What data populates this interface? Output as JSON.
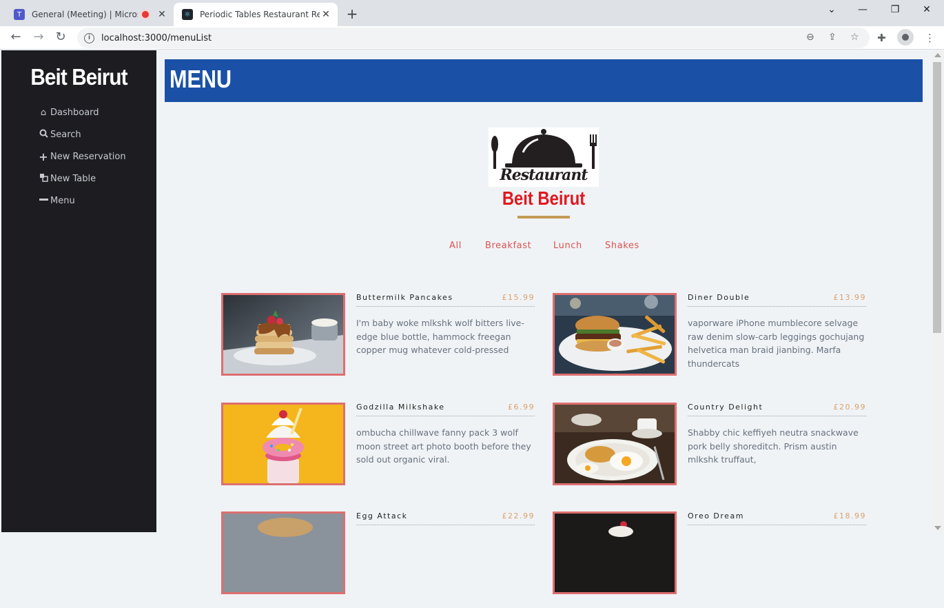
{
  "browser": {
    "tabs": [
      {
        "title": "General (Meeting) | Microsof",
        "favicon": "teams-icon",
        "active": false
      },
      {
        "title": "Periodic Tables Restaurant Reserv",
        "favicon": "react-icon",
        "active": true
      }
    ],
    "url": "localhost:3000/menuList"
  },
  "sidebar": {
    "brand": "Beit Beirut",
    "items": [
      {
        "label": "Dashboard",
        "icon": "home-icon"
      },
      {
        "label": "Search",
        "icon": "search-icon"
      },
      {
        "label": "New Reservation",
        "icon": "plus-icon"
      },
      {
        "label": "New Table",
        "icon": "table-icon"
      },
      {
        "label": "Menu",
        "icon": "minus-icon"
      }
    ]
  },
  "header": {
    "title": "MENU"
  },
  "logo": {
    "text": "Restaurant"
  },
  "restaurant_name": "Beit Beirut",
  "filters": [
    "All",
    "Breakfast",
    "Lunch",
    "Shakes"
  ],
  "menu_items": [
    {
      "name": "Buttermilk Pancakes",
      "price": "£15.99",
      "description": "I'm baby woke mlkshk wolf bitters live-edge blue bottle, hammock freegan copper mug whatever cold-pressed"
    },
    {
      "name": "Diner Double",
      "price": "£13.99",
      "description": "vaporware iPhone mumblecore selvage raw denim slow-carb leggings gochujang helvetica man braid jianbing. Marfa thundercats"
    },
    {
      "name": "Godzilla Milkshake",
      "price": "£6.99",
      "description": "ombucha chillwave fanny pack 3 wolf moon street art photo booth before they sold out organic viral."
    },
    {
      "name": "Country Delight",
      "price": "£20.99",
      "description": "Shabby chic keffiyeh neutra snackwave pork belly shoreditch. Prism austin mlkshk truffaut,"
    },
    {
      "name": "Egg Attack",
      "price": "£22.99",
      "description": ""
    },
    {
      "name": "Oreo Dream",
      "price": "£18.99",
      "description": ""
    }
  ],
  "colors": {
    "sidebar": "#1c1c21",
    "header": "#1a51a6",
    "accent_red": "#e2171f",
    "filter": "#d9534f",
    "price": "#d9a06b",
    "photo_border": "#dd6f6f"
  }
}
